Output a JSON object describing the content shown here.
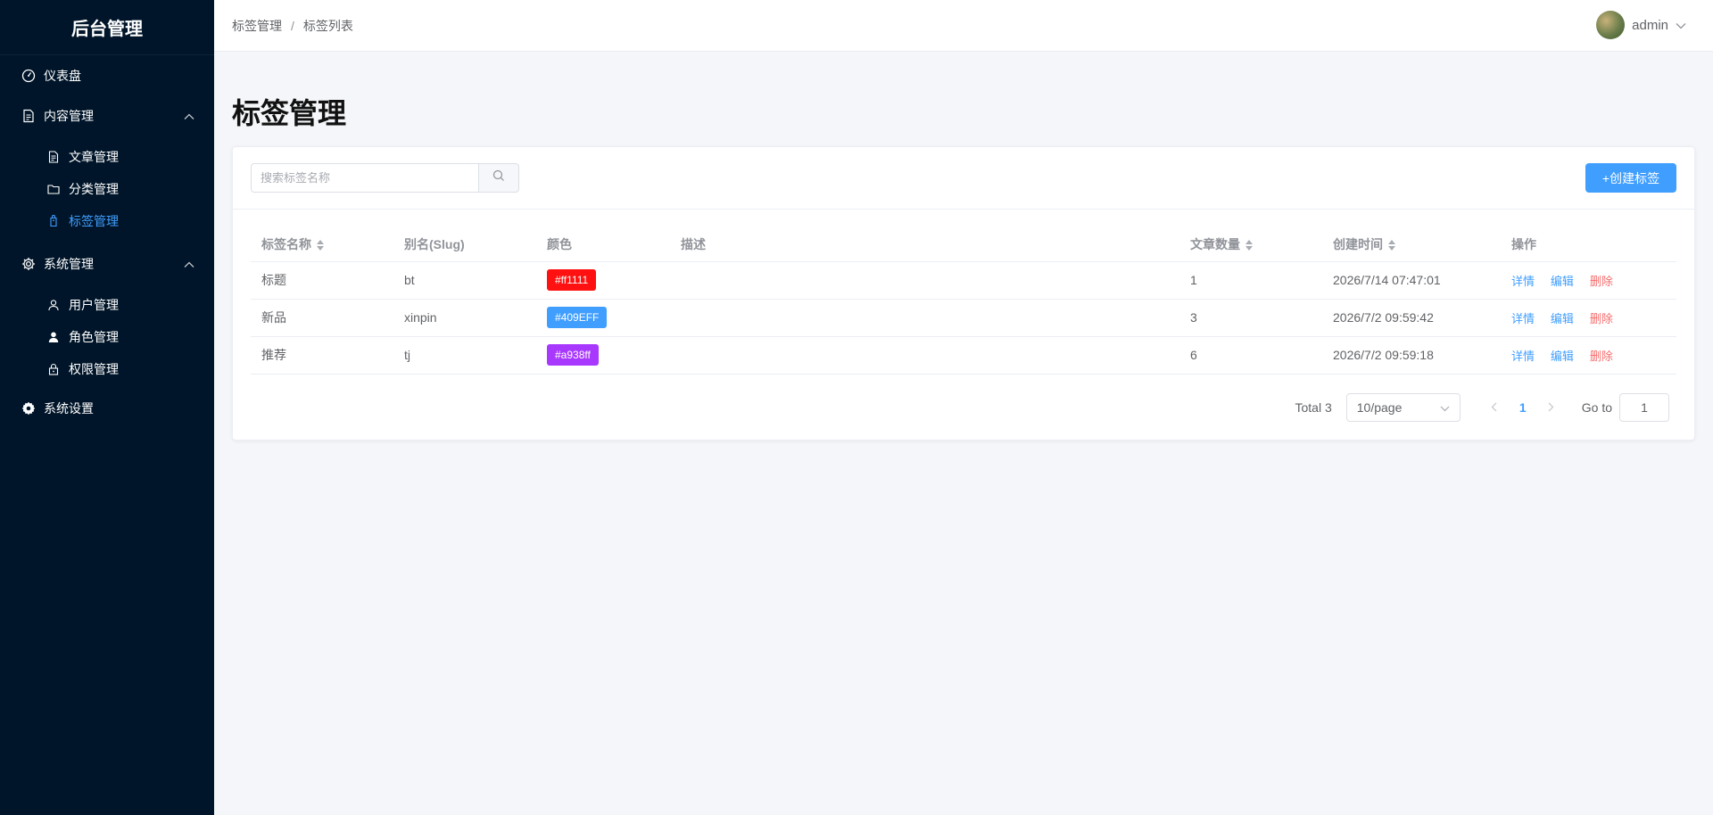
{
  "sidebar": {
    "title": "后台管理",
    "items": [
      {
        "label": "仪表盘",
        "icon": "dashboard-icon"
      },
      {
        "label": "内容管理",
        "icon": "document-icon",
        "expanded": true,
        "children": [
          {
            "label": "文章管理",
            "icon": "document-icon"
          },
          {
            "label": "分类管理",
            "icon": "folder-icon"
          },
          {
            "label": "标签管理",
            "icon": "tag-icon",
            "active": true
          }
        ]
      },
      {
        "label": "系统管理",
        "icon": "gear-icon",
        "expanded": true,
        "children": [
          {
            "label": "用户管理",
            "icon": "user-icon"
          },
          {
            "label": "角色管理",
            "icon": "user-filled-icon"
          },
          {
            "label": "权限管理",
            "icon": "lock-icon"
          }
        ]
      },
      {
        "label": "系统设置",
        "icon": "settings-icon"
      }
    ]
  },
  "header": {
    "breadcrumb": [
      "标签管理",
      "标签列表"
    ],
    "breadcrumb_sep": "/",
    "user": "admin"
  },
  "page": {
    "title": "标签管理",
    "search_placeholder": "搜索标签名称",
    "create_label": "+创建标签"
  },
  "table": {
    "columns": [
      "标签名称",
      "别名(Slug)",
      "颜色",
      "描述",
      "文章数量",
      "创建时间",
      "操作"
    ],
    "rows": [
      {
        "name": "标题",
        "slug": "bt",
        "color": "#ff1111",
        "color_bg": "#ff1111",
        "desc": "",
        "count": "1",
        "created": "2026/7/14 07:47:01"
      },
      {
        "name": "新品",
        "slug": "xinpin",
        "color": "#409EFF",
        "color_bg": "#409EFF",
        "desc": "",
        "count": "3",
        "created": "2026/7/2 09:59:42"
      },
      {
        "name": "推荐",
        "slug": "tj",
        "color": "#a938ff",
        "color_bg": "#a938ff",
        "desc": "",
        "count": "6",
        "created": "2026/7/2 09:59:18"
      }
    ],
    "actions": {
      "detail": "详情",
      "edit": "编辑",
      "delete": "删除"
    }
  },
  "pagination": {
    "total": "Total 3",
    "page_size": "10/page",
    "current": "1",
    "goto_label": "Go to",
    "goto_value": "1"
  },
  "colors": {
    "sidebar_bg": "#001529",
    "primary": "#409eff",
    "danger": "#f56c6c"
  }
}
